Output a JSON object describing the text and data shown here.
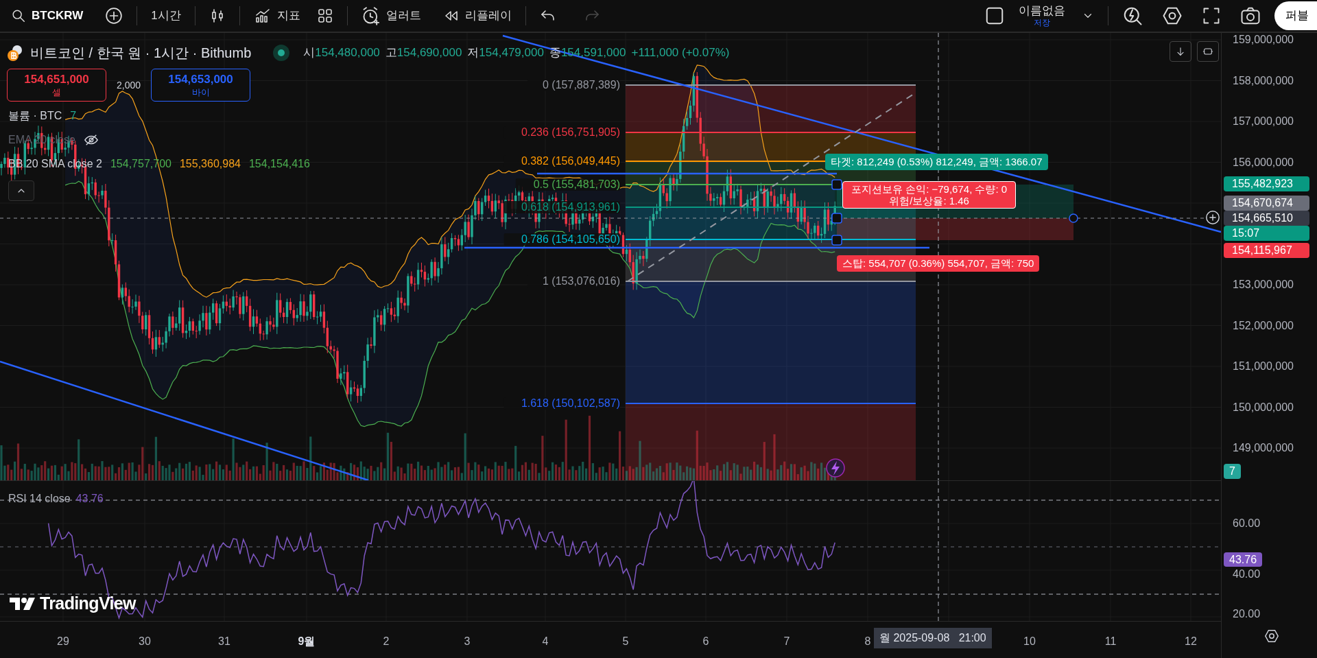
{
  "toolbar": {
    "symbol": "BTCKRW",
    "interval": "1시간",
    "indicators_label": "지표",
    "alert_label": "얼러트",
    "replay_label": "리플레이",
    "layout_name": "이름없음",
    "save_label": "저장",
    "publish_label": "퍼블"
  },
  "legend": {
    "title": "비트코인 / 한국 원 · 1시간 · Bithumb",
    "ohlc": [
      {
        "label": "시",
        "value": "154,480,000"
      },
      {
        "label": "고",
        "value": "154,690,000"
      },
      {
        "label": "저",
        "value": "154,479,000"
      },
      {
        "label": "종",
        "value": "154,591,000"
      }
    ],
    "change": "+111,000 (+0.07%)"
  },
  "trade": {
    "sell_price": "154,651,000",
    "sell_label": "셀",
    "spread": "2,000",
    "buy_price": "154,653,000",
    "buy_label": "바이"
  },
  "indicators": [
    {
      "label": "볼륨 · BTC",
      "hidden": false,
      "values": [
        {
          "text": "7",
          "color": "#22ab94"
        }
      ]
    },
    {
      "label": "EMA 20 close",
      "hidden": true
    },
    {
      "label": "BB 20 SMA close 2",
      "hidden": false,
      "values": [
        {
          "text": "154,757,700",
          "color": "#4caf50"
        },
        {
          "text": "155,360,984",
          "color": "#f7a21b"
        },
        {
          "text": "154,154,416",
          "color": "#4caf50"
        }
      ]
    }
  ],
  "fib_levels": [
    {
      "label": "0 (157,887,389)",
      "color": "#9598a1"
    },
    {
      "label": "0.236 (156,751,905)",
      "color": "#f23645"
    },
    {
      "label": "0.382 (156,049,445)",
      "color": "#ff9800"
    },
    {
      "label": "0.5 (155,481,703)",
      "color": "#4caf50"
    },
    {
      "label": "0.618 (154,913,961)",
      "color": "#089981"
    },
    {
      "label": "0.786 (154,105,650)",
      "color": "#00bcd4"
    },
    {
      "label": "1 (153,076,016)",
      "color": "#9598a1"
    },
    {
      "label": "1.618 (150,102,587)",
      "color": "#2962ff"
    }
  ],
  "position": {
    "target_label": "타겟: 812,249 (0.53%) 812,249, 금액: 1366.07",
    "status_lines": [
      "포지션보유 손익: −79,674, 수량: 0",
      "위험/보상율: 1.46"
    ],
    "stop_label": "스탑: 554,707 (0.36%) 554,707, 금액: 750"
  },
  "price_axis": {
    "ticks": [
      "159,000,000",
      "158,000,000",
      "157,000,000",
      "156,000,000",
      "153,000,000",
      "152,000,000",
      "151,000,000",
      "150,000,000",
      "149,000,000"
    ],
    "tags": [
      {
        "text": "155,482,923",
        "color": "#089981"
      },
      {
        "text": "154,670,674",
        "color": "#6a6d78"
      },
      {
        "text": "154,665,510",
        "color": "#363a45"
      },
      {
        "text": "15:07",
        "color": "#089981"
      },
      {
        "text": "154,115,967",
        "color": "#f23645"
      }
    ],
    "volume_tag": "7"
  },
  "rsi": {
    "label": "RSI 14 close",
    "value": "43.76",
    "ticks": [
      "60.00",
      "40.00",
      "20.00"
    ],
    "tag": "43.76"
  },
  "branding": "TradingView",
  "time_axis": {
    "labels": [
      {
        "text": "29",
        "kind": "day"
      },
      {
        "text": "30",
        "kind": "day"
      },
      {
        "text": "31",
        "kind": "day"
      },
      {
        "text": "9월",
        "kind": "month"
      },
      {
        "text": "2",
        "kind": "day"
      },
      {
        "text": "3",
        "kind": "day"
      },
      {
        "text": "4",
        "kind": "day"
      },
      {
        "text": "5",
        "kind": "day"
      },
      {
        "text": "6",
        "kind": "day"
      },
      {
        "text": "7",
        "kind": "day"
      },
      {
        "text": "8",
        "kind": "day"
      },
      {
        "text": "10",
        "kind": "day"
      },
      {
        "text": "11",
        "kind": "day"
      },
      {
        "text": "12",
        "kind": "day"
      }
    ],
    "crosshair_label": "월 2025-09-08   21:00"
  }
}
